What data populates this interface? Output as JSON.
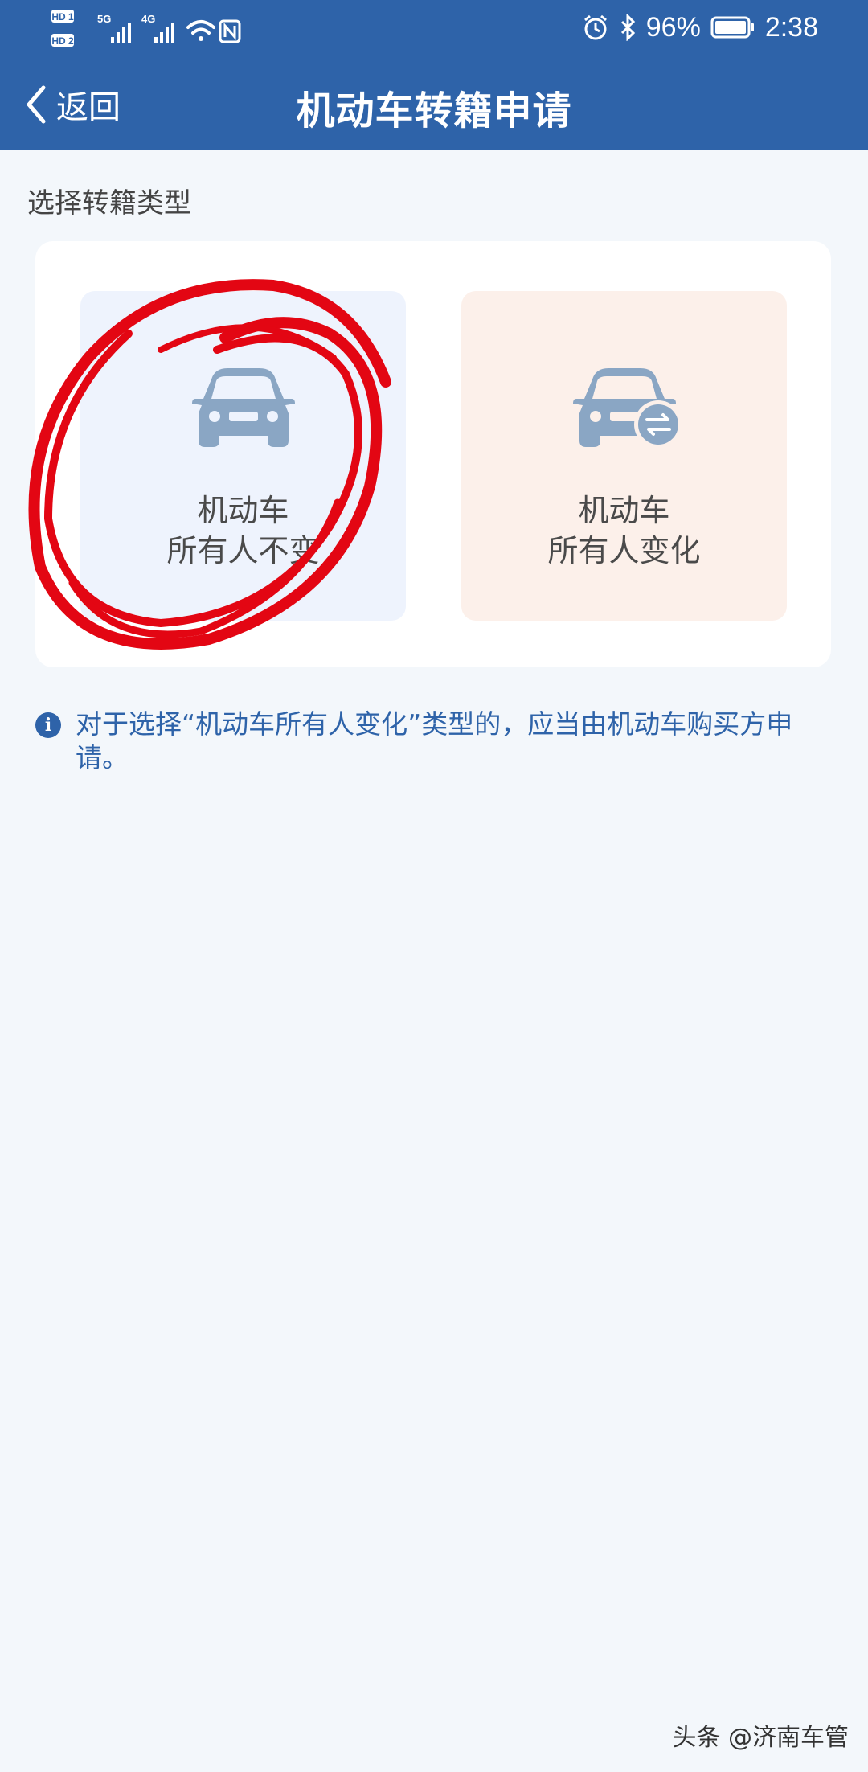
{
  "status_bar": {
    "hd1": "HD 1",
    "hd2": "HD 2",
    "net1": "5G",
    "net2": "4G",
    "battery": "96%",
    "time": "2:38"
  },
  "nav": {
    "back_label": "返回",
    "title": "机动车转籍申请"
  },
  "section_label": "选择转籍类型",
  "options": [
    {
      "line1": "机动车",
      "line2": "所有人不变",
      "icon": "car-icon"
    },
    {
      "line1": "机动车",
      "line2": "所有人变化",
      "icon": "car-transfer-icon"
    }
  ],
  "tip": "对于选择“机动车所有人变化”类型的，应当由机动车购买方申请。",
  "watermark": "头条 @济南车管",
  "colors": {
    "header": "#2e63a9",
    "accent": "#2e63a9",
    "icon": "#8aa6c4",
    "annotation": "#e30613"
  }
}
